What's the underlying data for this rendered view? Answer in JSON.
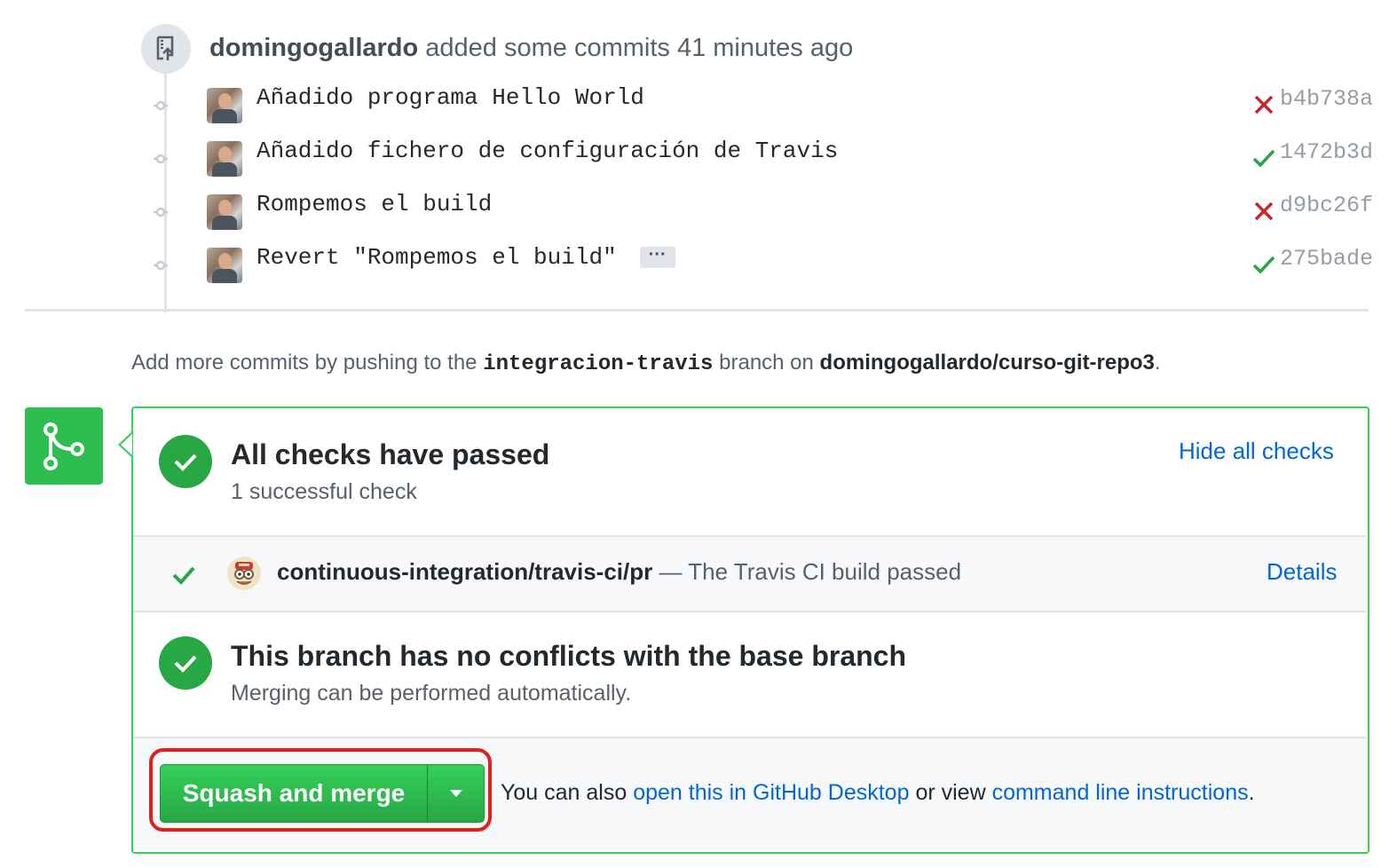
{
  "event": {
    "author": "domingogallardo",
    "text": "added some commits 41 minutes ago",
    "icon": "repo-push-icon"
  },
  "commits": [
    {
      "message": "Añadido programa Hello World",
      "sha": "b4b738a",
      "status": "failure",
      "has_ellipsis": false
    },
    {
      "message": "Añadido fichero de configuración de Travis",
      "sha": "1472b3d",
      "status": "success",
      "has_ellipsis": false
    },
    {
      "message": "Rompemos el build",
      "sha": "d9bc26f",
      "status": "failure",
      "has_ellipsis": false
    },
    {
      "message": "Revert \"Rompemos el build\"",
      "sha": "275bade",
      "status": "success",
      "has_ellipsis": true,
      "ellipsis": "···"
    }
  ],
  "push_note": {
    "prefix": "Add more commits by pushing to the",
    "branch": "integracion-travis",
    "middle": "branch on",
    "repo": "domingogallardo/curso-git-repo3",
    "suffix": "."
  },
  "checks": {
    "title": "All checks have passed",
    "subtitle": "1 successful check",
    "toggle_label": "Hide all checks",
    "items": [
      {
        "context": "continuous-integration/travis-ci/pr",
        "description": "— The Travis CI build passed",
        "details_label": "Details"
      }
    ]
  },
  "conflicts": {
    "title": "This branch has no conflicts with the base branch",
    "subtitle": "Merging can be performed automatically."
  },
  "merge": {
    "button_label": "Squash and merge",
    "footer_prefix": "You can also",
    "desktop_link": "open this in GitHub Desktop",
    "footer_middle": "or view",
    "cli_link": "command line instructions",
    "footer_suffix": "."
  },
  "colors": {
    "success": "#28a745",
    "failure": "#cb2431",
    "link": "#0366d6",
    "highlight": "#e0201b"
  }
}
